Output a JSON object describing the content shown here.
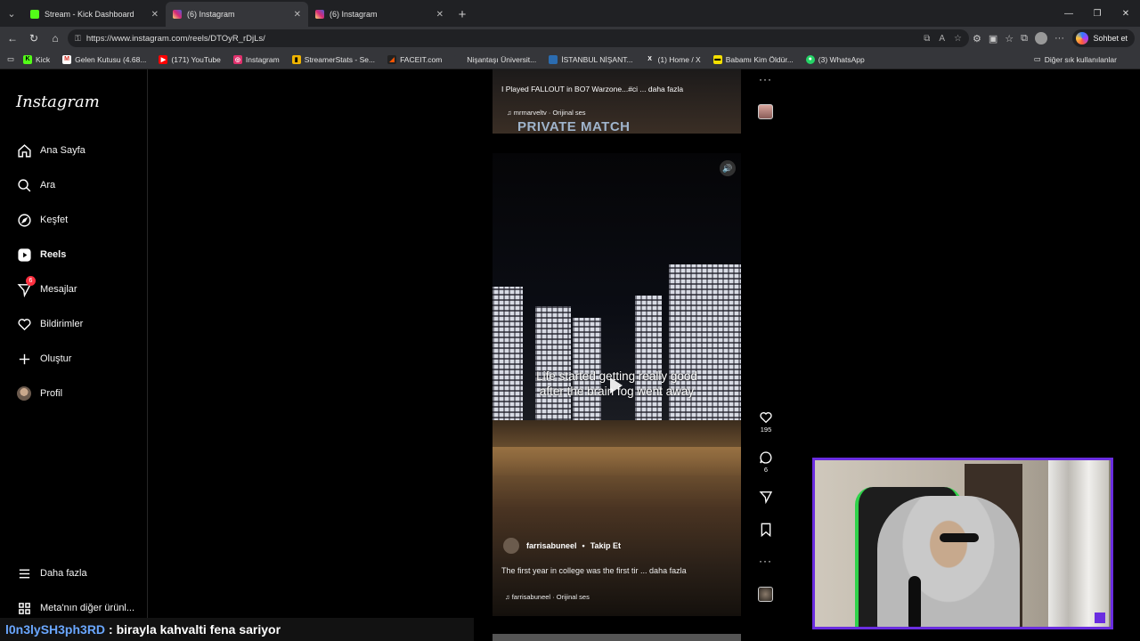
{
  "browser": {
    "tabs": [
      {
        "title": "Stream - Kick Dashboard",
        "favicon_color": "#53fc18",
        "favicon_letter": "K"
      },
      {
        "title": "(6) Instagram",
        "favicon_color": "#e1306c"
      },
      {
        "title": "(6) Instagram",
        "favicon_color": "#e1306c"
      }
    ],
    "url": "https://www.instagram.com/reels/DTOyR_rDjLs/",
    "copilot_label": "Sohbet et",
    "bookmarks": [
      {
        "label": "Kick",
        "color": "#53fc18",
        "glyph": "K"
      },
      {
        "label": "Gelen Kutusu (4.68...",
        "color": "#ffffff",
        "glyph": "M"
      },
      {
        "label": "(171) YouTube",
        "color": "#ff0000",
        "glyph": "▶"
      },
      {
        "label": "Instagram",
        "color": "#e1306c",
        "glyph": "◎"
      },
      {
        "label": "StreamerStats - Se...",
        "color": "#f0b400",
        "glyph": "▮"
      },
      {
        "label": "FACEIT.com",
        "color": "#ff5500",
        "glyph": "◢"
      },
      {
        "label": "Nişantaşı Üniversit...",
        "color": "#35363a",
        "glyph": ""
      },
      {
        "label": "İSTANBUL NİŞANT...",
        "color": "#2b6cb0",
        "glyph": "▌"
      },
      {
        "label": "(1) Home / X",
        "color": "#35363a",
        "glyph": "X"
      },
      {
        "label": "Babamı Kim Öldür...",
        "color": "#f5e000",
        "glyph": "▬"
      },
      {
        "label": "(3) WhatsApp",
        "color": "#25d366",
        "glyph": "●"
      }
    ],
    "other_bookmarks": "Diğer sık kullanılanlar"
  },
  "sidebar": {
    "logo": "Instagram",
    "items": [
      {
        "label": "Ana Sayfa",
        "icon": "home-icon"
      },
      {
        "label": "Ara",
        "icon": "search-icon"
      },
      {
        "label": "Keşfet",
        "icon": "explore-icon"
      },
      {
        "label": "Reels",
        "icon": "reels-icon"
      },
      {
        "label": "Mesajlar",
        "icon": "messenger-icon",
        "badge": "6"
      },
      {
        "label": "Bildirimler",
        "icon": "heart-icon"
      },
      {
        "label": "Oluştur",
        "icon": "plus-icon"
      },
      {
        "label": "Profil",
        "icon": "avatar"
      }
    ],
    "more": "Daha fazla",
    "meta": "Meta'nın diğer ürünl..."
  },
  "prev_reel": {
    "caption": "I Played FALLOUT in BO7 Warzone...#ci ... daha fazla",
    "audio": "mrmarveltv · Orijinal ses",
    "overlay": "PRIVATE MATCH"
  },
  "reel": {
    "overlay_line1": "Life started getting really good",
    "overlay_line2": "after the brain fog went away",
    "author": "farrisabuneel",
    "follow": "Takip Et",
    "caption": "The first year in college was the first tir ... daha fazla",
    "audio": "farrisabuneel · Orijinal ses",
    "likes": "195",
    "comments": "6"
  },
  "chat": {
    "user": "l0n3lySH3ph3RD",
    "message": ": birayla kahvalti fena sariyor"
  }
}
